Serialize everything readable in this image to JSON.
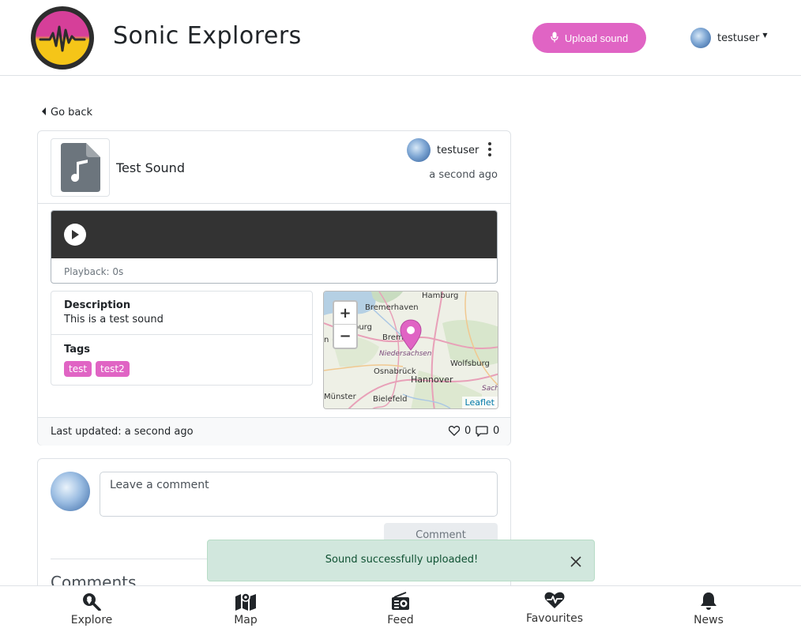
{
  "header": {
    "brand": "Sonic Explorers",
    "upload_label": "Upload sound",
    "username": "testuser"
  },
  "nav": {
    "go_back": "Go back"
  },
  "sound": {
    "title": "Test Sound",
    "owner": "testuser",
    "time_ago": "a second ago",
    "playback": "Playback: 0s",
    "description_label": "Description",
    "description": "This is a test sound",
    "tags_label": "Tags",
    "tags": [
      "test",
      "test2"
    ],
    "last_updated": "Last updated: a second ago",
    "likes": "0",
    "comments": "0"
  },
  "map": {
    "labels": [
      "Hamburg",
      "Bremerhaven",
      "Bremen",
      "Niedersachsen",
      "Wolfsburg",
      "Osnabrück",
      "Hannover",
      "Sach",
      "Münster",
      "Bielefeld",
      "burg",
      "n"
    ],
    "zoom_in": "+",
    "zoom_out": "−",
    "attribution": "Leaflet"
  },
  "comment_form": {
    "placeholder": "Leave a comment",
    "button": "Comment",
    "heading": "Comments"
  },
  "toast": {
    "message": "Sound successfully uploaded!"
  },
  "bottom_nav": {
    "explore": "Explore",
    "map": "Map",
    "feed": "Feed",
    "favourites": "Favourites",
    "news": "News"
  },
  "colors": {
    "accent": "#e064c4",
    "toast_bg": "#d1e7dd",
    "player_bg": "#333333"
  }
}
